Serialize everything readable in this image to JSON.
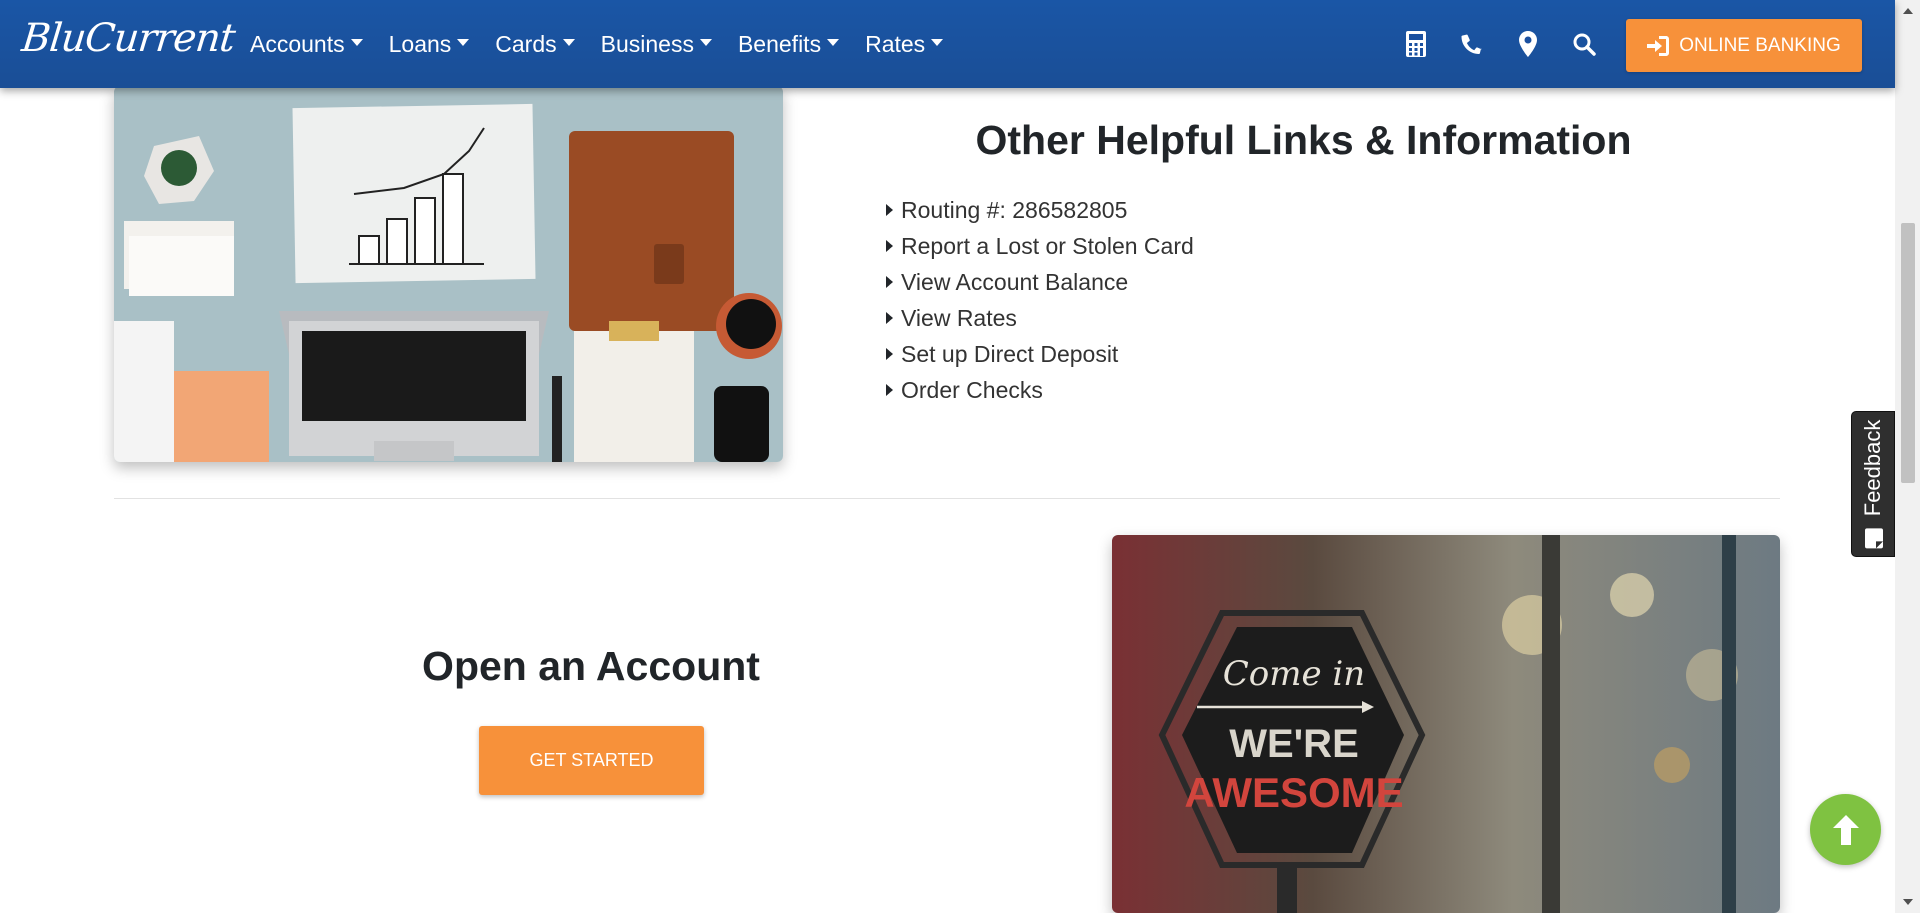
{
  "header": {
    "logo": "BluCurrent",
    "nav": [
      {
        "label": "Accounts"
      },
      {
        "label": "Loans"
      },
      {
        "label": "Cards"
      },
      {
        "label": "Business"
      },
      {
        "label": "Benefits"
      },
      {
        "label": "Rates"
      }
    ],
    "icons": [
      "calculator-icon",
      "phone-icon",
      "map-marker-icon",
      "search-icon"
    ],
    "online_banking_label": "ONLINE BANKING"
  },
  "helpful_links": {
    "title": "Other Helpful Links & Information",
    "items": [
      {
        "label": "Routing #: 286582805"
      },
      {
        "label": "Report a Lost or Stolen Card"
      },
      {
        "label": "View Account Balance"
      },
      {
        "label": "View Rates"
      },
      {
        "label": "Set up Direct Deposit"
      },
      {
        "label": "Order Checks"
      }
    ],
    "image_alt": "desk with chart, laptop and notebook"
  },
  "open_account": {
    "title": "Open an Account",
    "button_label": "GET STARTED",
    "sign_line1": "Come in",
    "sign_line2": "WE'RE",
    "sign_line3": "AWESOME"
  },
  "feedback": {
    "label": "Feedback"
  },
  "colors": {
    "header_bg": "#1a50a0",
    "accent_orange": "#f7913a",
    "back_to_top_green": "#7fc241",
    "feedback_bg": "#2f2f2f"
  }
}
